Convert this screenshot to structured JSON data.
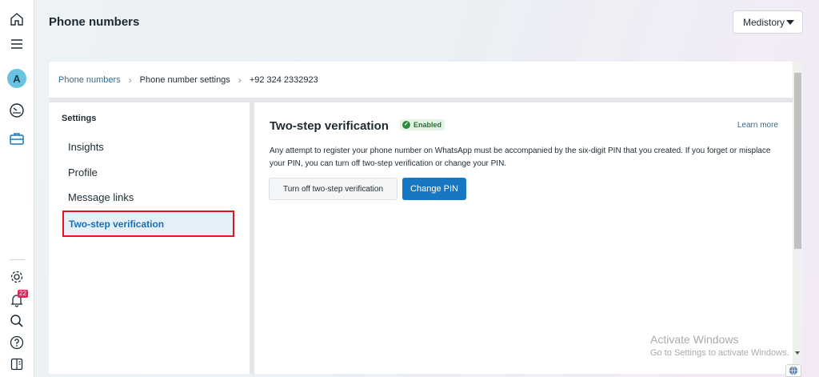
{
  "rail": {
    "avatar_letter": "A",
    "notifications_count": "22",
    "icons": [
      "home-icon",
      "menu-icon",
      "dashboard-gauge-icon",
      "briefcase-icon",
      "gear-icon",
      "bell-icon",
      "search-icon",
      "help-icon",
      "panel-toggle-icon"
    ]
  },
  "header": {
    "title": "Phone numbers",
    "account_name": "Medistory"
  },
  "breadcrumb": {
    "items": [
      "Phone numbers",
      "Phone number settings",
      "+92 324 2332923"
    ]
  },
  "settings": {
    "title": "Settings",
    "items": [
      "Insights",
      "Profile",
      "Message links",
      "Two-step verification"
    ],
    "active_item": "Two-step verification"
  },
  "content": {
    "title": "Two-step verification",
    "status": "Enabled",
    "learn_more": "Learn more",
    "description": "Any attempt to register your phone number on WhatsApp must be accompanied by the six-digit PIN that you created. If you forget or misplace your PIN, you can turn off two-step verification or change your PIN.",
    "turn_off_label": "Turn off two-step verification",
    "change_pin_label": "Change PIN"
  },
  "watermark": {
    "line1": "Activate Windows",
    "line2": "Go to Settings to activate Windows."
  },
  "colors": {
    "accent": "#1877c2",
    "link": "#386c8c",
    "highlight_border": "#e0161b",
    "enabled_green": "#2e8a3d"
  }
}
